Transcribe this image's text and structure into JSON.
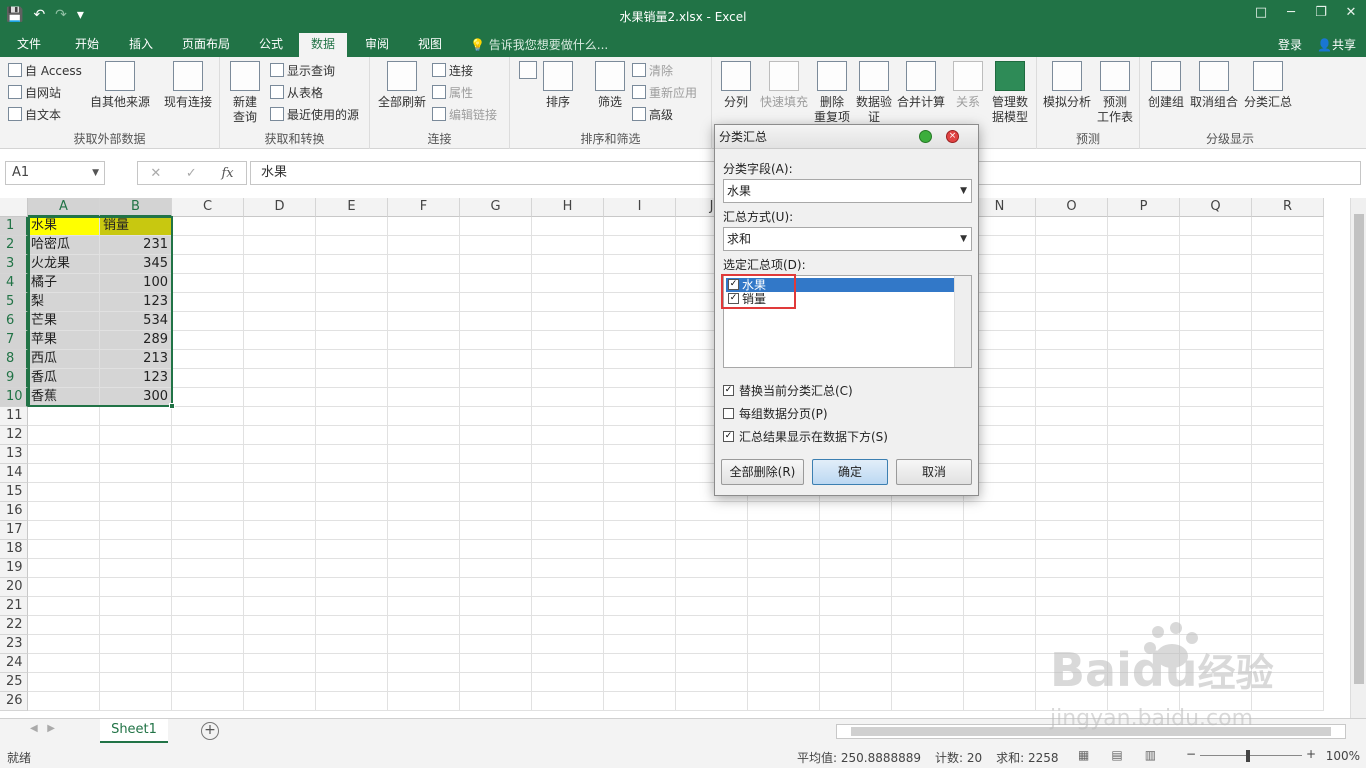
{
  "window": {
    "title": "水果销量2.xlsx - Excel",
    "controls": [
      "□",
      "─",
      "❐",
      "✕"
    ]
  },
  "qat": {
    "save": "💾",
    "undo": "↶",
    "redo": "↷",
    "more": "▾"
  },
  "tabs": [
    "文件",
    "开始",
    "插入",
    "页面布局",
    "公式",
    "数据",
    "审阅",
    "视图"
  ],
  "active_tab": "数据",
  "tell_me": "告诉我您想要做什么...",
  "signin": "登录",
  "share": "共享",
  "ribbon": {
    "get_external": {
      "label": "获取外部数据",
      "access": "自 Access",
      "web": "自网站",
      "text": "自文本",
      "other": "自其他来源",
      "existing": "现有连接"
    },
    "get_transform": {
      "label": "获取和转换",
      "new_query": "新建",
      "new_query2": "查询",
      "show_queries": "显示查询",
      "from_table": "从表格",
      "recent": "最近使用的源"
    },
    "connections": {
      "label": "连接",
      "refresh_all": "全部刷新",
      "connections": "连接",
      "properties": "属性",
      "edit_links": "编辑链接"
    },
    "sort_filter": {
      "label": "排序和筛选",
      "sort": "排序",
      "filter": "筛选",
      "clear": "清除",
      "reapply": "重新应用",
      "advanced": "高级"
    },
    "data_tools": {
      "split": "分列",
      "flash_fill": "快速填充",
      "remove_dup": "删除",
      "remove_dup2": "重复项",
      "validation": "数据验",
      "validation2": "证",
      "consolidate": "合并计算",
      "relationships": "关系",
      "data_model": "管理数",
      "data_model2": "据模型"
    },
    "forecast": {
      "label": "预测",
      "whatif": "模拟分析",
      "forecast_sheet": "预测",
      "forecast_sheet2": "工作表"
    },
    "outline": {
      "label": "分级显示",
      "group": "创建组",
      "ungroup": "取消组合",
      "subtotal": "分类汇总"
    }
  },
  "formula_bar": {
    "name_box": "A1",
    "cancel": "✕",
    "enter": "✓",
    "fx": "fx",
    "value": "水果"
  },
  "columns": [
    "A",
    "B",
    "C",
    "D",
    "E",
    "F",
    "G",
    "H",
    "I",
    "J",
    "K",
    "L",
    "M",
    "N",
    "O",
    "P",
    "Q",
    "R"
  ],
  "rows": [
    "1",
    "2",
    "3",
    "4",
    "5",
    "6",
    "7",
    "8",
    "9",
    "10",
    "11",
    "12",
    "13",
    "14",
    "15",
    "16",
    "17",
    "18",
    "19",
    "20",
    "21",
    "22",
    "23",
    "24",
    "25",
    "26"
  ],
  "table": {
    "headers": [
      "水果",
      "销量"
    ],
    "data": [
      [
        "哈密瓜",
        "231"
      ],
      [
        "火龙果",
        "345"
      ],
      [
        "橘子",
        "100"
      ],
      [
        "梨",
        "123"
      ],
      [
        "芒果",
        "534"
      ],
      [
        "苹果",
        "289"
      ],
      [
        "西瓜",
        "213"
      ],
      [
        "香瓜",
        "123"
      ],
      [
        "香蕉",
        "300"
      ]
    ]
  },
  "sheet_tab": "Sheet1",
  "add_sheet": "+",
  "status": {
    "ready": "就绪",
    "average": "平均值: 250.8888889",
    "count": "计数: 20",
    "sum": "求和: 2258",
    "zoom": "100%"
  },
  "dialog": {
    "title": "分类汇总",
    "field_label": "分类字段(A):",
    "field_value": "水果",
    "function_label": "汇总方式(U):",
    "function_value": "求和",
    "add_to_label": "选定汇总项(D):",
    "items": [
      {
        "label": "水果",
        "checked": true
      },
      {
        "label": "销量",
        "checked": true
      }
    ],
    "replace": "替换当前分类汇总(C)",
    "page_break": "每组数据分页(P)",
    "summary_below": "汇总结果显示在数据下方(S)",
    "remove_all": "全部删除(R)",
    "ok": "确定",
    "cancel": "取消",
    "close_glyph": "×"
  },
  "watermark": {
    "brand": "Bai",
    "brand2": "du",
    "cn": "经验",
    "url": "jingyan.baidu.com"
  }
}
